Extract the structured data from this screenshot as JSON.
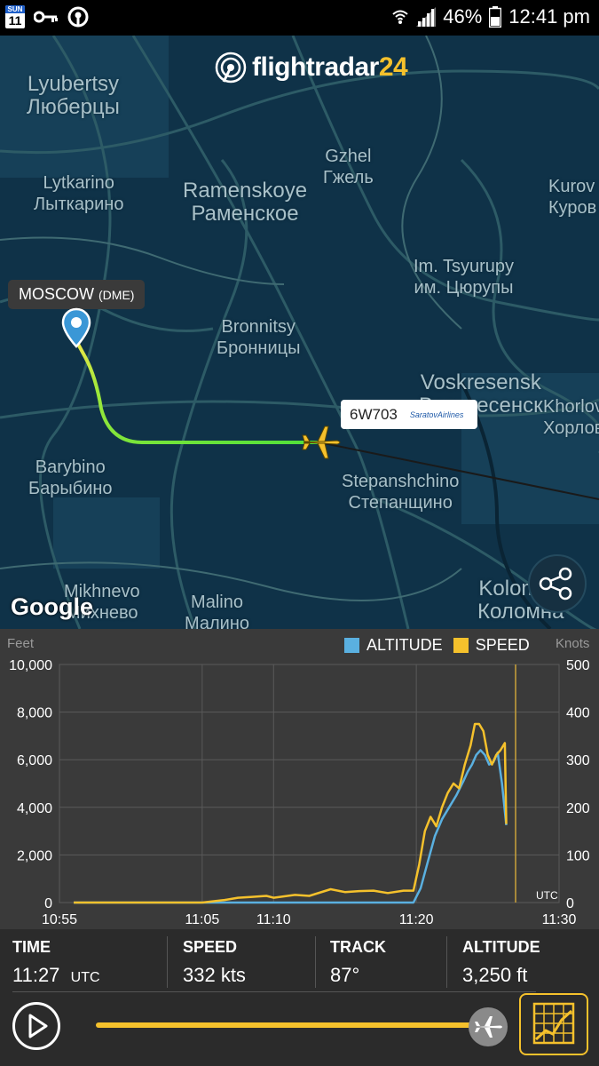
{
  "status_bar": {
    "calendar_day_of_week": "SUN",
    "calendar_day": "11",
    "battery": "46%",
    "time": "12:41 pm"
  },
  "map": {
    "logo_text": "flightradar",
    "logo_number": "24",
    "places": [
      {
        "en": "Lyubertsy",
        "ru": "Люберцы"
      },
      {
        "en": "Lytkarino",
        "ru": "Лыткарино"
      },
      {
        "en": "Ramenskoye",
        "ru": "Раменское"
      },
      {
        "en": "Gzhel",
        "ru": "Гжель"
      },
      {
        "en": "Kurov",
        "ru": "Куров"
      },
      {
        "en": "Im. Tsyurupy",
        "ru": "им. Цюрупы"
      },
      {
        "en": "Bronnitsy",
        "ru": "Бронницы"
      },
      {
        "en": "Voskresensk",
        "ru": "Воскресенск"
      },
      {
        "en": "Khorlov",
        "ru": "Хорлов"
      },
      {
        "en": "Barybino",
        "ru": "Барыбино"
      },
      {
        "en": "Stepanshchino",
        "ru": "Степанщино"
      },
      {
        "en": "Mikhnevo",
        "ru": "Михнево"
      },
      {
        "en": "Malino",
        "ru": "Малино"
      },
      {
        "en": "Kolomna",
        "ru": "Коломна"
      }
    ],
    "airport_name": "MOSCOW",
    "airport_code": "(DME)",
    "flight_number": "6W703",
    "airline_name": "SaratovAirlines",
    "map_credit": "Google"
  },
  "chart": {
    "left_unit": "Feet",
    "right_unit": "Knots",
    "legend_altitude": "ALTITUDE",
    "legend_speed": "SPEED",
    "utc_label": "UTC",
    "colors": {
      "altitude": "#5ab0e0",
      "speed": "#f5c12c"
    }
  },
  "chart_data": {
    "type": "line",
    "x_tick_labels": [
      "10:55",
      "11:05",
      "11:10",
      "11:20",
      "11:30"
    ],
    "y_left_ticks": [
      "0",
      "2,000",
      "4,000",
      "6,000",
      "8,000",
      "10,000"
    ],
    "y_right_ticks": [
      "0",
      "100",
      "200",
      "300",
      "400",
      "500"
    ],
    "ylim_left": [
      0,
      10000
    ],
    "ylim_right": [
      0,
      500
    ],
    "xlim_minutes_after_1055": [
      0,
      35
    ],
    "series": [
      {
        "name": "ALTITUDE",
        "axis": "left",
        "x": [
          1,
          10,
          20,
          24.8,
          25.3,
          25.8,
          26.3,
          26.8,
          27.3,
          27.8,
          28.3,
          28.6,
          28.9,
          29.2,
          29.5,
          29.8,
          30.1,
          30.4,
          30.7,
          31,
          31.3
        ],
        "y": [
          0,
          0,
          0,
          0,
          600,
          1700,
          2800,
          3500,
          4000,
          4500,
          5100,
          5500,
          5800,
          6200,
          6400,
          6200,
          5800,
          5900,
          6300,
          5000,
          3250
        ]
      },
      {
        "name": "SPEED",
        "axis": "right",
        "x": [
          1,
          10,
          11.5,
          12.5,
          13.5,
          14.5,
          15,
          16.5,
          17.5,
          19,
          20,
          21,
          22,
          23,
          24.1,
          24.8,
          25.2,
          25.6,
          26,
          26.4,
          26.8,
          27.2,
          27.6,
          28,
          28.4,
          28.8,
          29.1,
          29.4,
          29.7,
          30,
          30.3,
          30.6,
          30.9,
          31.2,
          31.3
        ],
        "y": [
          0,
          0,
          5,
          10,
          12,
          14,
          10,
          16,
          14,
          28,
          22,
          24,
          25,
          20,
          25,
          25,
          80,
          150,
          180,
          160,
          200,
          230,
          250,
          240,
          290,
          330,
          375,
          375,
          360,
          310,
          290,
          310,
          320,
          335,
          165
        ]
      }
    ]
  },
  "stats": {
    "time_label": "TIME",
    "time_value": "11:27",
    "time_unit": "UTC",
    "speed_label": "SPEED",
    "speed_value": "332 kts",
    "track_label": "TRACK",
    "track_value": "87°",
    "altitude_label": "ALTITUDE",
    "altitude_value": "3,250 ft",
    "playback_progress": 0.96
  }
}
